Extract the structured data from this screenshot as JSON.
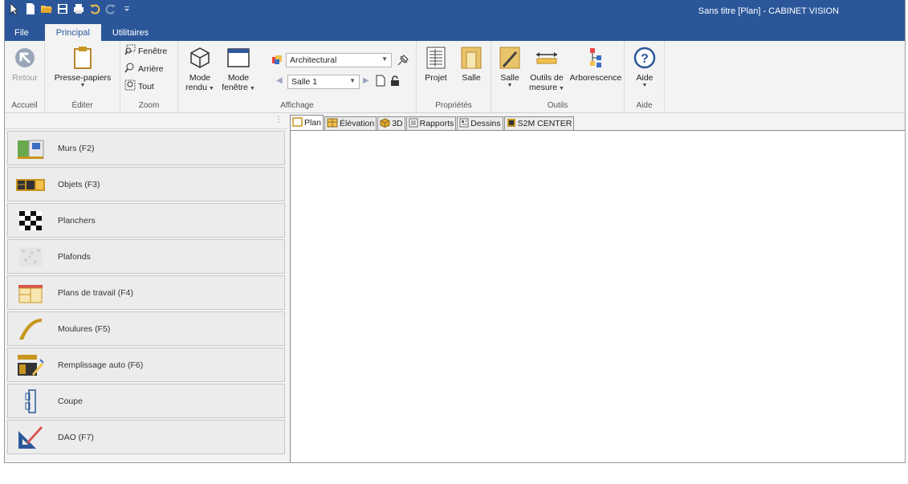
{
  "window": {
    "title": "Sans titre [Plan] - CABINET VISION"
  },
  "qat": {
    "icons": [
      "pointer-icon",
      "new-file-icon",
      "open-folder-icon",
      "save-icon",
      "print-icon",
      "undo-icon",
      "redo-icon",
      "customize-icon"
    ]
  },
  "menu_tabs": [
    {
      "label": "File",
      "active": false
    },
    {
      "label": "Principal",
      "active": true
    },
    {
      "label": "Utilitaires",
      "active": false
    }
  ],
  "ribbon": {
    "accueil": {
      "label": "Accueil",
      "retour": "Retour"
    },
    "editer": {
      "label": "Éditer",
      "presse_papiers": "Presse-papiers"
    },
    "zoom": {
      "label": "Zoom",
      "fenetre": "Fenêtre",
      "arriere": "Arrière",
      "tout": "Tout"
    },
    "affichage": {
      "label": "Affichage",
      "mode_rendu_1": "Mode",
      "mode_rendu_2": "rendu",
      "mode_fenetre_1": "Mode",
      "mode_fenetre_2": "fenêtre",
      "view_combo": "Architectural",
      "room_combo": "Salle 1"
    },
    "proprietes": {
      "label": "Propriétés",
      "projet": "Projet",
      "salle": "Salle"
    },
    "outils": {
      "label": "Outils",
      "salle": "Salle",
      "outils_mesure_1": "Outils de",
      "outils_mesure_2": "mesure",
      "arborescence": "Arborescence"
    },
    "aide": {
      "label": "Aide",
      "aide": "Aide"
    }
  },
  "left_panel": {
    "items": [
      {
        "label": "Murs (F2)",
        "icon": "walls-icon"
      },
      {
        "label": "Objets (F3)",
        "icon": "objects-icon"
      },
      {
        "label": "Planchers",
        "icon": "floors-icon"
      },
      {
        "label": "Plafonds",
        "icon": "ceilings-icon"
      },
      {
        "label": "Plans de travail (F4)",
        "icon": "countertops-icon"
      },
      {
        "label": "Moulures (F5)",
        "icon": "moldings-icon"
      },
      {
        "label": "Remplissage auto (F6)",
        "icon": "autofill-icon"
      },
      {
        "label": "Coupe",
        "icon": "section-icon"
      },
      {
        "label": "DAO (F7)",
        "icon": "cad-icon"
      }
    ]
  },
  "view_tabs": [
    {
      "label": "Plan",
      "active": true
    },
    {
      "label": "Élévation",
      "active": false
    },
    {
      "label": "3D",
      "active": false
    },
    {
      "label": "Rapports",
      "active": false
    },
    {
      "label": "Dessins",
      "active": false
    },
    {
      "label": "S2M CENTER",
      "active": false
    }
  ],
  "colors": {
    "titlebar": "#2b579a",
    "accent_gold": "#c8961e"
  }
}
